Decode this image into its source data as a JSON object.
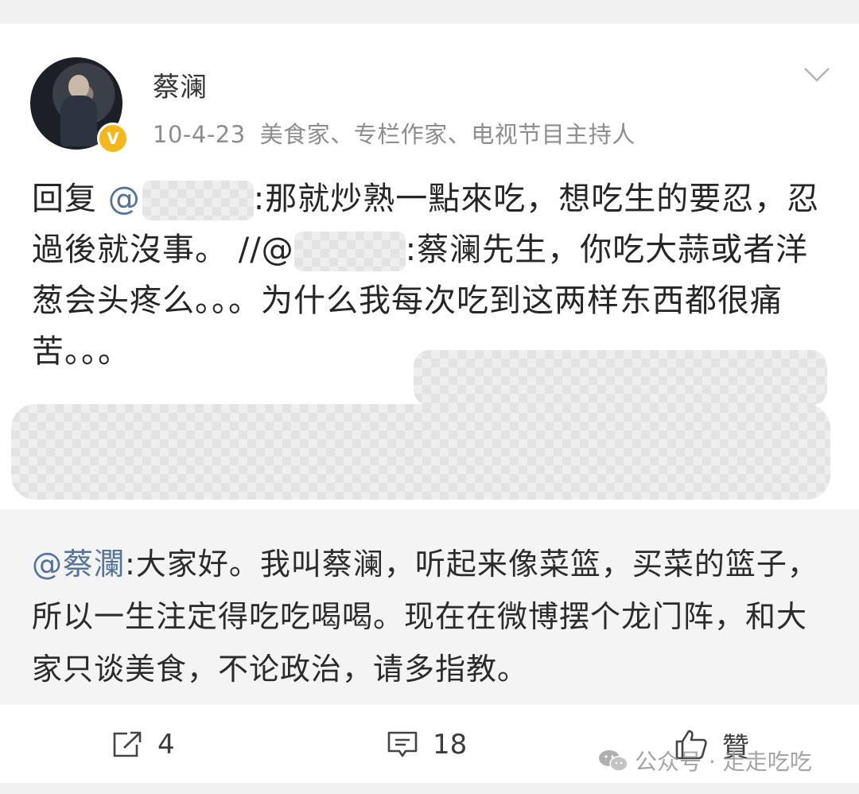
{
  "post": {
    "author": "蔡澜",
    "date": "10-4-23",
    "description": "美食家、专栏作家、电视节目主持人",
    "reply_prefix": "回复 ",
    "mention_at": "@",
    "reply_text": ":那就炒熟一點來吃，想吃生的要忍，忍過後就沒事。",
    "forward_sep": "  //@",
    "forward_text": ":蔡澜先生，你吃大蒜或者洋葱会头疼么。。。为什么我每次吃到这两样东西都很痛苦。。。"
  },
  "repost": {
    "mention": "@蔡瀾",
    "text": ":大家好。我叫蔡澜，听起来像菜篮，买菜的篮子，所以一生注定得吃吃喝喝。现在在微博摆个龙门阵，和大家只谈美食，不论政治，请多指教。"
  },
  "actions": {
    "share_count": "4",
    "comment_count": "18",
    "like_label": "贊"
  },
  "watermark": {
    "text": "公众号 · 走走吃吃"
  },
  "colors": {
    "mention": "#55739a",
    "badge": "#f6b71b",
    "repost_bg": "#f4f4f4"
  },
  "icons": [
    "share-icon",
    "comment-icon",
    "like-icon",
    "chevron-down-icon",
    "verified-badge-icon",
    "wechat-icon"
  ]
}
